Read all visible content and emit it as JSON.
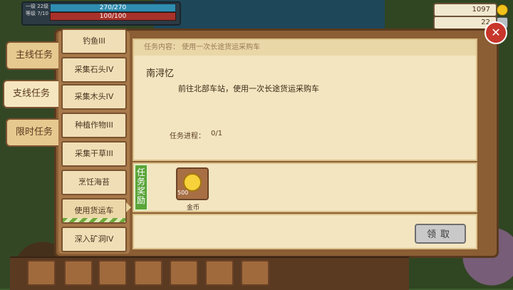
{
  "hud": {
    "level": "一级 22级",
    "exp": "等级 7/10",
    "mp_text": "270/270",
    "hp_text": "100/100",
    "gold": "1097",
    "stone": "22"
  },
  "side_tabs": [
    {
      "label": "主线任务"
    },
    {
      "label": "支线任务"
    },
    {
      "label": "限时任务"
    }
  ],
  "quests": [
    {
      "label": "钓鱼III"
    },
    {
      "label": "采集石头IV"
    },
    {
      "label": "采集木头IV"
    },
    {
      "label": "种植作物III"
    },
    {
      "label": "采集干草III"
    },
    {
      "label": "烹饪海苔"
    },
    {
      "label": "使用货运车"
    },
    {
      "label": "深入矿洞IV"
    }
  ],
  "detail": {
    "header": "任务内容：   使用一次长途货运采购车",
    "title": "南浔忆",
    "description": "前往北部车站，使用一次长途货运采购车",
    "progress_label": "任务进程：",
    "progress_value": "0/1"
  },
  "reward": {
    "label": "任务奖励",
    "item_count": "500",
    "item_name": "金币",
    "icon": "gold-coin-icon"
  },
  "claim_button": "领取",
  "close_icon": "close-icon",
  "colors": {
    "panel": "#8b5e34",
    "paper": "#f3e5c0",
    "reward_green": "#5aa53a",
    "close_red": "#c8362c"
  }
}
